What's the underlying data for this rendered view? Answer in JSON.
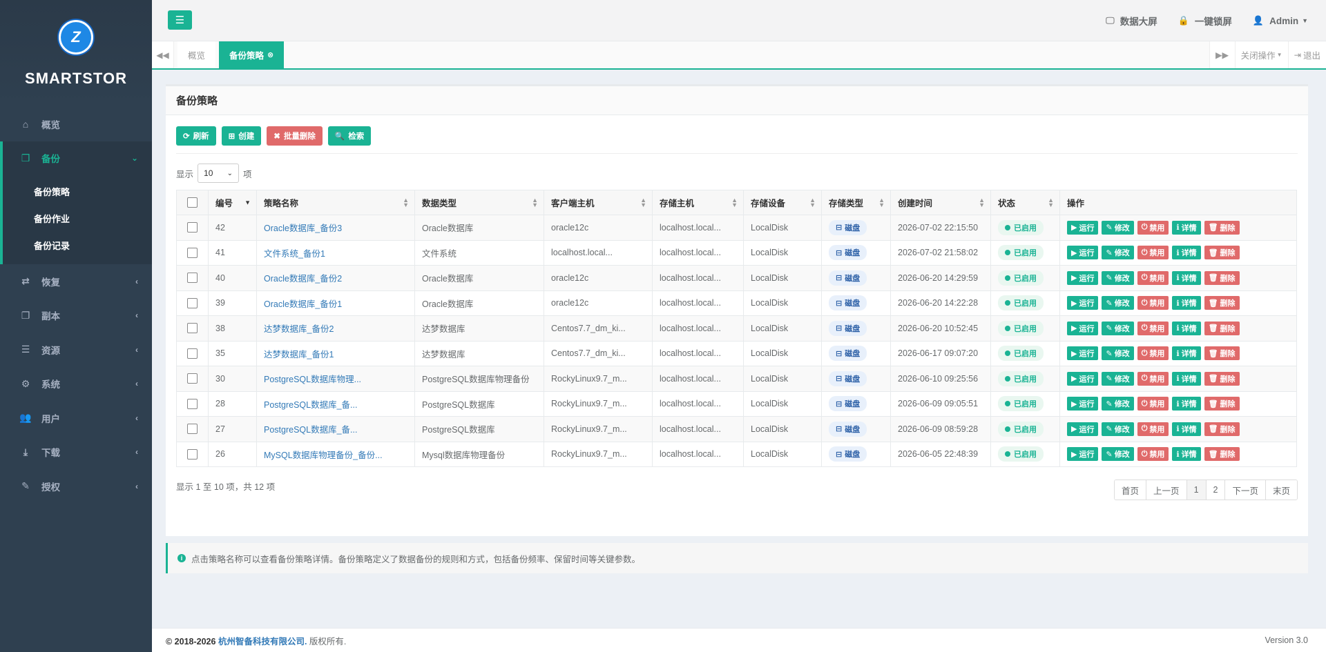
{
  "sidebar": {
    "logo_letter": "Z",
    "brand": "SMARTSTOR",
    "items": [
      {
        "label": "概览",
        "icon": "home-icon"
      },
      {
        "label": "备份",
        "icon": "cube-icon"
      },
      {
        "label": "恢复",
        "icon": "retweet-icon"
      },
      {
        "label": "副本",
        "icon": "copy-icon"
      },
      {
        "label": "资源",
        "icon": "server-icon"
      },
      {
        "label": "系统",
        "icon": "cogs-icon"
      },
      {
        "label": "用户",
        "icon": "users-icon"
      },
      {
        "label": "下载",
        "icon": "download-icon"
      },
      {
        "label": "授权",
        "icon": "edit-icon"
      }
    ],
    "sub_items": [
      "备份策略",
      "备份作业",
      "备份记录"
    ]
  },
  "topbar": {
    "links": [
      "数据大屏",
      "一键锁屏",
      "Admin"
    ]
  },
  "tabs": {
    "items": [
      "概览",
      "备份策略"
    ],
    "close_ops": "关闭操作",
    "logout": "退出"
  },
  "panel": {
    "title": "备份策略",
    "buttons": [
      "刷新",
      "创建",
      "批量删除",
      "检索"
    ],
    "show_label": "显示",
    "page_size": "10",
    "items_label": "项"
  },
  "table": {
    "headers": [
      "编号",
      "策略名称",
      "数据类型",
      "客户端主机",
      "存储主机",
      "存储设备",
      "存储类型",
      "创建时间",
      "状态",
      "操作"
    ],
    "ops": [
      "运行",
      "修改",
      "禁用",
      "详情",
      "删除"
    ],
    "rows": [
      {
        "id": "42",
        "name": "Oracle数据库_备份3",
        "dtype": "Oracle数据库",
        "client": "oracle12c",
        "shost": "localhost.local...",
        "sdev": "LocalDisk",
        "stype": "磁盘",
        "time": "2026-07-02 22:15:50",
        "status": "已启用"
      },
      {
        "id": "41",
        "name": "文件系统_备份1",
        "dtype": "文件系统",
        "client": "localhost.local...",
        "shost": "localhost.local...",
        "sdev": "LocalDisk",
        "stype": "磁盘",
        "time": "2026-07-02 21:58:02",
        "status": "已启用"
      },
      {
        "id": "40",
        "name": "Oracle数据库_备份2",
        "dtype": "Oracle数据库",
        "client": "oracle12c",
        "shost": "localhost.local...",
        "sdev": "LocalDisk",
        "stype": "磁盘",
        "time": "2026-06-20 14:29:59",
        "status": "已启用"
      },
      {
        "id": "39",
        "name": "Oracle数据库_备份1",
        "dtype": "Oracle数据库",
        "client": "oracle12c",
        "shost": "localhost.local...",
        "sdev": "LocalDisk",
        "stype": "磁盘",
        "time": "2026-06-20 14:22:28",
        "status": "已启用"
      },
      {
        "id": "38",
        "name": "达梦数据库_备份2",
        "dtype": "达梦数据库",
        "client": "Centos7.7_dm_ki...",
        "shost": "localhost.local...",
        "sdev": "LocalDisk",
        "stype": "磁盘",
        "time": "2026-06-20 10:52:45",
        "status": "已启用"
      },
      {
        "id": "35",
        "name": "达梦数据库_备份1",
        "dtype": "达梦数据库",
        "client": "Centos7.7_dm_ki...",
        "shost": "localhost.local...",
        "sdev": "LocalDisk",
        "stype": "磁盘",
        "time": "2026-06-17 09:07:20",
        "status": "已启用"
      },
      {
        "id": "30",
        "name": "PostgreSQL数据库物理...",
        "dtype": "PostgreSQL数据库物理备份",
        "client": "RockyLinux9.7_m...",
        "shost": "localhost.local...",
        "sdev": "LocalDisk",
        "stype": "磁盘",
        "time": "2026-06-10 09:25:56",
        "status": "已启用"
      },
      {
        "id": "28",
        "name": "PostgreSQL数据库_备...",
        "dtype": "PostgreSQL数据库",
        "client": "RockyLinux9.7_m...",
        "shost": "localhost.local...",
        "sdev": "LocalDisk",
        "stype": "磁盘",
        "time": "2026-06-09 09:05:51",
        "status": "已启用"
      },
      {
        "id": "27",
        "name": "PostgreSQL数据库_备...",
        "dtype": "PostgreSQL数据库",
        "client": "RockyLinux9.7_m...",
        "shost": "localhost.local...",
        "sdev": "LocalDisk",
        "stype": "磁盘",
        "time": "2026-06-09 08:59:28",
        "status": "已启用"
      },
      {
        "id": "26",
        "name": "MySQL数据库物理备份_备份...",
        "dtype": "Mysql数据库物理备份",
        "client": "RockyLinux9.7_m...",
        "shost": "localhost.local...",
        "sdev": "LocalDisk",
        "stype": "磁盘",
        "time": "2026-06-05 22:48:39",
        "status": "已启用"
      }
    ]
  },
  "pagination": {
    "info": "显示 1 至 10 项，共 12 项",
    "pages": [
      "首页",
      "上一页",
      "1",
      "2",
      "下一页",
      "末页"
    ],
    "current": "1"
  },
  "tip": "点击策略名称可以查看备份策略详情。备份策略定义了数据备份的规则和方式，包括备份频率、保留时间等关键参数。",
  "footer": {
    "prefix": "© 2018-2026",
    "company": "杭州智备科技有限公司.",
    "suffix": "版权所有.",
    "version": "Version 3.0"
  },
  "colors": {
    "accent": "#1ab394",
    "danger": "#e06a6a",
    "sidebar_bg": "#2f4050"
  }
}
